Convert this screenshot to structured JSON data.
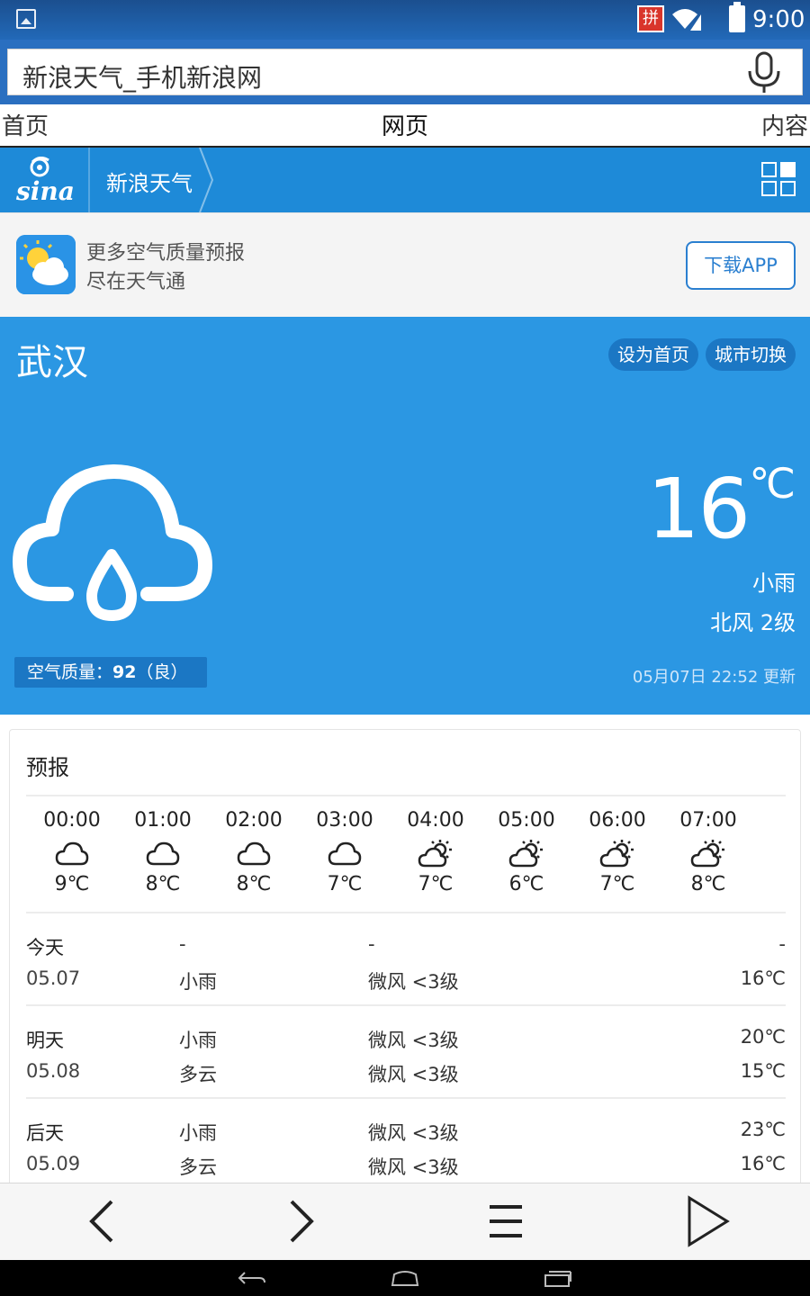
{
  "status_bar": {
    "time": "9:00",
    "ime_label": "拼",
    "icons": [
      "gallery-icon",
      "wifi-icon",
      "signal-icon",
      "battery-charging-icon"
    ]
  },
  "address_bar": {
    "url_title": "新浪天气_手机新浪网",
    "mic_icon": "microphone-icon"
  },
  "tabs": [
    {
      "label": "首页",
      "active": false
    },
    {
      "label": "网页",
      "active": true
    },
    {
      "label": "内容",
      "active": false
    }
  ],
  "sina_header": {
    "logo_text": "sina",
    "section": "新浪天气",
    "menu_icon": "grid-icon"
  },
  "promo": {
    "line1": "更多空气质量预报",
    "line2": "尽在天气通",
    "button": "下载APP"
  },
  "weather": {
    "city": "武汉",
    "set_home": "设为首页",
    "switch_city": "城市切换",
    "temperature": "16",
    "unit": "℃",
    "condition": "小雨",
    "wind": "北风 2级",
    "aqi_label": "空气质量：",
    "aqi_value": "92",
    "aqi_level": "（良）",
    "updated": "05月07日 22:52 更新"
  },
  "forecast": {
    "title": "预报",
    "hourly": [
      {
        "time": "00:00",
        "icon": "cloud-icon",
        "temp": "9℃"
      },
      {
        "time": "01:00",
        "icon": "cloud-icon",
        "temp": "8℃"
      },
      {
        "time": "02:00",
        "icon": "cloud-icon",
        "temp": "8℃"
      },
      {
        "time": "03:00",
        "icon": "cloud-icon",
        "temp": "7℃"
      },
      {
        "time": "04:00",
        "icon": "partly-cloudy-icon",
        "temp": "7℃"
      },
      {
        "time": "05:00",
        "icon": "partly-cloudy-icon",
        "temp": "6℃"
      },
      {
        "time": "06:00",
        "icon": "partly-cloudy-icon",
        "temp": "7℃"
      },
      {
        "time": "07:00",
        "icon": "partly-cloudy-icon",
        "temp": "8℃"
      }
    ],
    "days": [
      {
        "name": "今天",
        "date": "05.07",
        "weather_day": "-",
        "weather_night": "小雨",
        "wind_day": "-",
        "wind_night": "微风 <3级",
        "temp_high": "-",
        "temp_low": "16℃"
      },
      {
        "name": "明天",
        "date": "05.08",
        "weather_day": "小雨",
        "weather_night": "多云",
        "wind_day": "微风 <3级",
        "wind_night": "微风 <3级",
        "temp_high": "20℃",
        "temp_low": "15℃"
      },
      {
        "name": "后天",
        "date": "05.09",
        "weather_day": "小雨",
        "weather_night": "多云",
        "wind_day": "微风 <3级",
        "wind_night": "微风 <3级",
        "temp_high": "23℃",
        "temp_low": "16℃"
      }
    ]
  },
  "toolbar": {
    "icons": [
      "back-arrow-icon",
      "forward-arrow-icon",
      "menu-icon",
      "play-icon"
    ]
  },
  "android_nav": {
    "icons": [
      "back-icon",
      "home-icon",
      "recents-icon"
    ]
  },
  "colors": {
    "status_bar": "#2269b8",
    "address_bar": "#2a6fc0",
    "sina_header": "#1e8ad8",
    "weather_bg": "#2b97e3",
    "pill_bg": "#1b77c4",
    "accent": "#2a7fd0"
  }
}
